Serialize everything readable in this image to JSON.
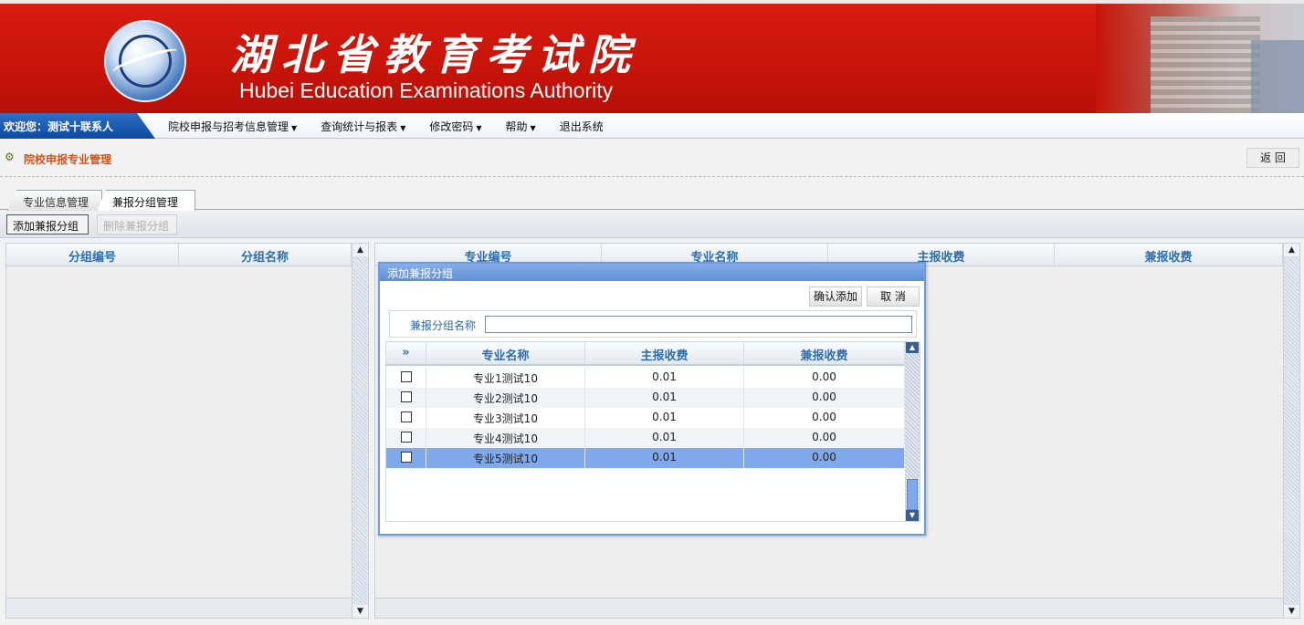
{
  "header": {
    "title_cn": "湖北省教育考试院",
    "title_en": "Hubei Education Examinations Authority"
  },
  "nav": {
    "welcome": "欢迎您：测试十联系人",
    "items": [
      {
        "label": "院校申报与招考信息管理",
        "dropdown": true
      },
      {
        "label": "查询统计与报表",
        "dropdown": true
      },
      {
        "label": "修改密码",
        "dropdown": true
      },
      {
        "label": "帮助",
        "dropdown": true
      },
      {
        "label": "退出系统",
        "dropdown": false
      }
    ]
  },
  "page": {
    "title": "院校申报专业管理",
    "back_label": "返 回"
  },
  "tabs": [
    {
      "label": "专业信息管理",
      "active": false
    },
    {
      "label": "兼报分组管理",
      "active": true
    }
  ],
  "toolbar": {
    "add_label": "添加兼报分组",
    "delete_label": "删除兼报分组"
  },
  "left_grid": {
    "columns": [
      "分组编号",
      "分组名称"
    ]
  },
  "right_grid": {
    "columns": [
      "专业编号",
      "专业名称",
      "主报收费",
      "兼报收费"
    ]
  },
  "dialog": {
    "title": "添加兼报分组",
    "confirm_label": "确认添加",
    "cancel_label": "取 消",
    "field_label": "兼报分组名称",
    "field_value": "",
    "columns": [
      "专业名称",
      "主报收费",
      "兼报收费"
    ],
    "rows": [
      {
        "name": "专业1测试10",
        "main_fee": "0.01",
        "side_fee": "0.00",
        "checked": false,
        "selected": false
      },
      {
        "name": "专业2测试10",
        "main_fee": "0.01",
        "side_fee": "0.00",
        "checked": false,
        "selected": false
      },
      {
        "name": "专业3测试10",
        "main_fee": "0.01",
        "side_fee": "0.00",
        "checked": false,
        "selected": false
      },
      {
        "name": "专业4测试10",
        "main_fee": "0.01",
        "side_fee": "0.00",
        "checked": false,
        "selected": false
      },
      {
        "name": "专业5测试10",
        "main_fee": "0.01",
        "side_fee": "0.00",
        "checked": false,
        "selected": true
      }
    ]
  },
  "colors": {
    "banner_red": "#c8140a",
    "accent_blue": "#2c6fb0",
    "selected_row": "#7fa9ec",
    "title_orange": "#d0541a"
  }
}
